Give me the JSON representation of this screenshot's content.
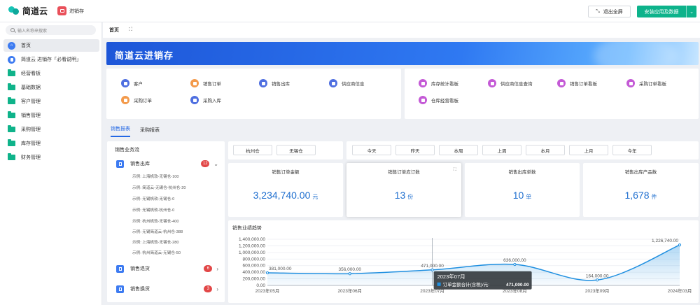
{
  "app": {
    "logo_text": "简道云",
    "app_name": "进销存"
  },
  "topbar": {
    "exit_fullscreen": "退出全屏",
    "install_label": "安装应用及数据"
  },
  "sidebar": {
    "search_placeholder": "输入名称来搜索",
    "items": [
      {
        "label": "首页",
        "icon": "home-icon",
        "active": true
      },
      {
        "label": "简道云 进销存「必看说明」",
        "icon": "doc-icon"
      },
      {
        "label": "经营看板",
        "icon": "folder-icon"
      },
      {
        "label": "基础数据",
        "icon": "folder-icon"
      },
      {
        "label": "客户管理",
        "icon": "folder-icon"
      },
      {
        "label": "销售管理",
        "icon": "folder-icon"
      },
      {
        "label": "采购管理",
        "icon": "folder-icon"
      },
      {
        "label": "库存管理",
        "icon": "folder-icon"
      },
      {
        "label": "财务管理",
        "icon": "folder-icon"
      }
    ]
  },
  "breadcrumb": {
    "home": "首页"
  },
  "banner": {
    "title": "简道云进销存"
  },
  "shortcuts_left": [
    {
      "label": "客户",
      "color": "#4f6fe0"
    },
    {
      "label": "销售订单",
      "color": "#f39a4b"
    },
    {
      "label": "销售出库",
      "color": "#4f6fe0"
    },
    {
      "label": "供应商信息",
      "color": "#4f6fe0"
    },
    {
      "label": "采购订单",
      "color": "#f39a4b"
    },
    {
      "label": "采购入库",
      "color": "#4f6fe0"
    }
  ],
  "shortcuts_right": [
    {
      "label": "库存统计看板",
      "color": "#c45ad6"
    },
    {
      "label": "供应商信息查询",
      "color": "#c45ad6"
    },
    {
      "label": "销售订单看板",
      "color": "#c45ad6"
    },
    {
      "label": "采购订单看板",
      "color": "#c45ad6"
    },
    {
      "label": "仓库经营看板",
      "color": "#c45ad6"
    }
  ],
  "tabs": [
    "销售报表",
    "采购报表"
  ],
  "flow": {
    "title": "销售业务流",
    "groups": [
      {
        "label": "销售出库",
        "count": "12",
        "expanded": true,
        "items": [
          "示例: 上海帆软-无锡仓-100",
          "示例: 简道云-无锡仓-杭州仓-20",
          "示例: 无锡帆软-无锡仓-0",
          "示例: 无锡帆软-杭州仓-0",
          "示例: 杭州帆软-无锡仓-400",
          "示例: 无锡简道云-杭州仓-388",
          "示例: 上海帆软-无锡仓-280",
          "示例: 杭州简道云-无锡仓-50"
        ]
      },
      {
        "label": "销售退货",
        "count": "6",
        "expanded": false
      },
      {
        "label": "销售换货",
        "count": "3",
        "expanded": false
      }
    ]
  },
  "filters": {
    "warehouses": [
      "杭州仓",
      "无锡仓"
    ],
    "periods": [
      "今天",
      "昨天",
      "本周",
      "上周",
      "本月",
      "上月",
      "今年"
    ]
  },
  "kpis": [
    {
      "title": "销售订单金额",
      "value": "3,234,740.00",
      "unit": "元"
    },
    {
      "title": "销售订单应订数",
      "value": "13",
      "unit": "份"
    },
    {
      "title": "销售出库单数",
      "value": "10",
      "unit": "单"
    },
    {
      "title": "销售出库产品数",
      "value": "1,678",
      "unit": "件"
    }
  ],
  "chart_title": "销售业绩趋势",
  "chart_data": {
    "type": "area",
    "categories": [
      "2023年05月",
      "2023年06月",
      "2023年07月",
      "2023年08月",
      "2023年09月",
      "2024年03月"
    ],
    "series": [
      {
        "name": "订单金额合计(含税)/元",
        "values": [
          381000,
          356000,
          471000,
          636000,
          164000,
          1226740
        ]
      }
    ],
    "data_labels": [
      "381,000.00",
      "356,000.00",
      "471,000.00",
      "636,000.00",
      "164,000.00",
      "1,226,740.00"
    ],
    "y_ticks": [
      "0.00",
      "200,000.00",
      "400,000.00",
      "600,000.00",
      "800,000.00",
      "1,000,000.00",
      "1,200,000.00",
      "1,400,000.00"
    ],
    "ylim": [
      0,
      1400000
    ],
    "grid": true,
    "tooltip": {
      "title": "2023年07月",
      "label": "订单金额合计(含税)/元:",
      "value": "471,000.00"
    },
    "line_color": "#1f8fe0"
  }
}
